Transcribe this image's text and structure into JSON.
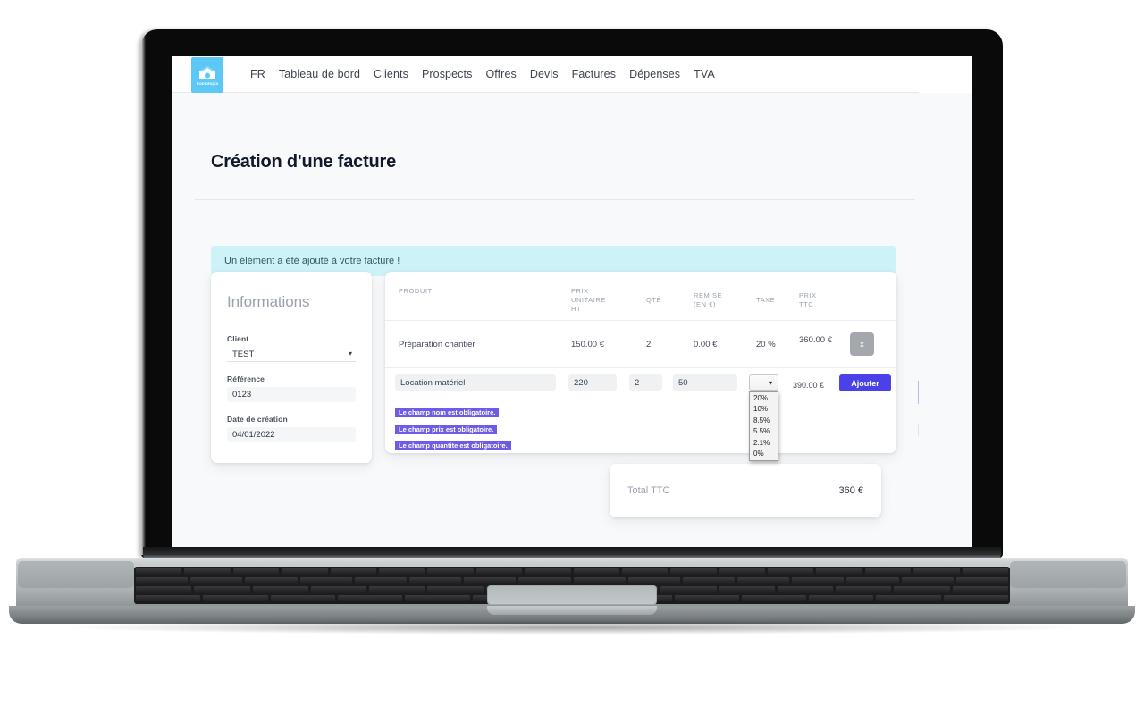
{
  "brand": {
    "name": "Comptopia",
    "logo_icon": "wallet-icon",
    "logo_bg": "#5bc8f5"
  },
  "nav": {
    "items": [
      {
        "label": "FR"
      },
      {
        "label": "Tableau de bord"
      },
      {
        "label": "Clients"
      },
      {
        "label": "Prospects"
      },
      {
        "label": "Offres"
      },
      {
        "label": "Devis"
      },
      {
        "label": "Factures"
      },
      {
        "label": "Dépenses"
      },
      {
        "label": "TVA"
      }
    ]
  },
  "page": {
    "title": "Création d'une facture"
  },
  "alert": {
    "message": "Un élément a été ajouté à votre facture !",
    "bg": "#cdf2f8"
  },
  "info_card": {
    "heading": "Informations",
    "fields": [
      {
        "label": "Client",
        "value": "TEST",
        "type": "select",
        "icon": "chevron-down-icon"
      },
      {
        "label": "Référence",
        "value": "0123",
        "type": "text"
      },
      {
        "label": "Date de création",
        "value": "04/01/2022",
        "type": "text"
      }
    ]
  },
  "products_table": {
    "headers": {
      "produit": "PRODUIT",
      "prix_unitaire_ht": "PRIX\nUNITAIRE\nHT",
      "prix_unitaire_ht_l1": "PRIX",
      "prix_unitaire_ht_l2": "UNITAIRE",
      "prix_unitaire_ht_l3": "HT",
      "qte": "QTÉ",
      "remise_l1": "REMISE",
      "remise_l2": "(EN €)",
      "taxe": "TAXE",
      "prix_ttc_l1": "PRIX",
      "prix_ttc_l2": "TTC"
    },
    "rows": [
      {
        "produit": "Préparation chantier",
        "prix_unitaire_ht": "150.00 €",
        "qte": "2",
        "remise": "0.00 €",
        "taxe": "20 %",
        "prix_ttc": "360.00 €",
        "delete_label": "x"
      }
    ],
    "form": {
      "produit_value": "Location matériel",
      "prix_value": "220",
      "qte_value": "2",
      "remise_value": "50",
      "taxe_selected": "",
      "taxe_options": [
        "20%",
        "10%",
        "8.5%",
        "5.5%",
        "2.1%",
        "0%"
      ],
      "prix_ttc": "390.00 €",
      "add_label": "Ajouter",
      "caret_icon": "chevron-down-icon"
    },
    "errors": [
      "Le champ nom est obligatoire.",
      "Le champ prix est obligatoire.",
      "Le champ quantite est obligatoire."
    ],
    "error_bg": "#6c5ce7"
  },
  "total_card": {
    "label": "Total TTC",
    "value": "360 €"
  },
  "theme": {
    "accent": "#4a42e8",
    "page_bg": "#f8f9fa",
    "card_bg": "#ffffff"
  }
}
